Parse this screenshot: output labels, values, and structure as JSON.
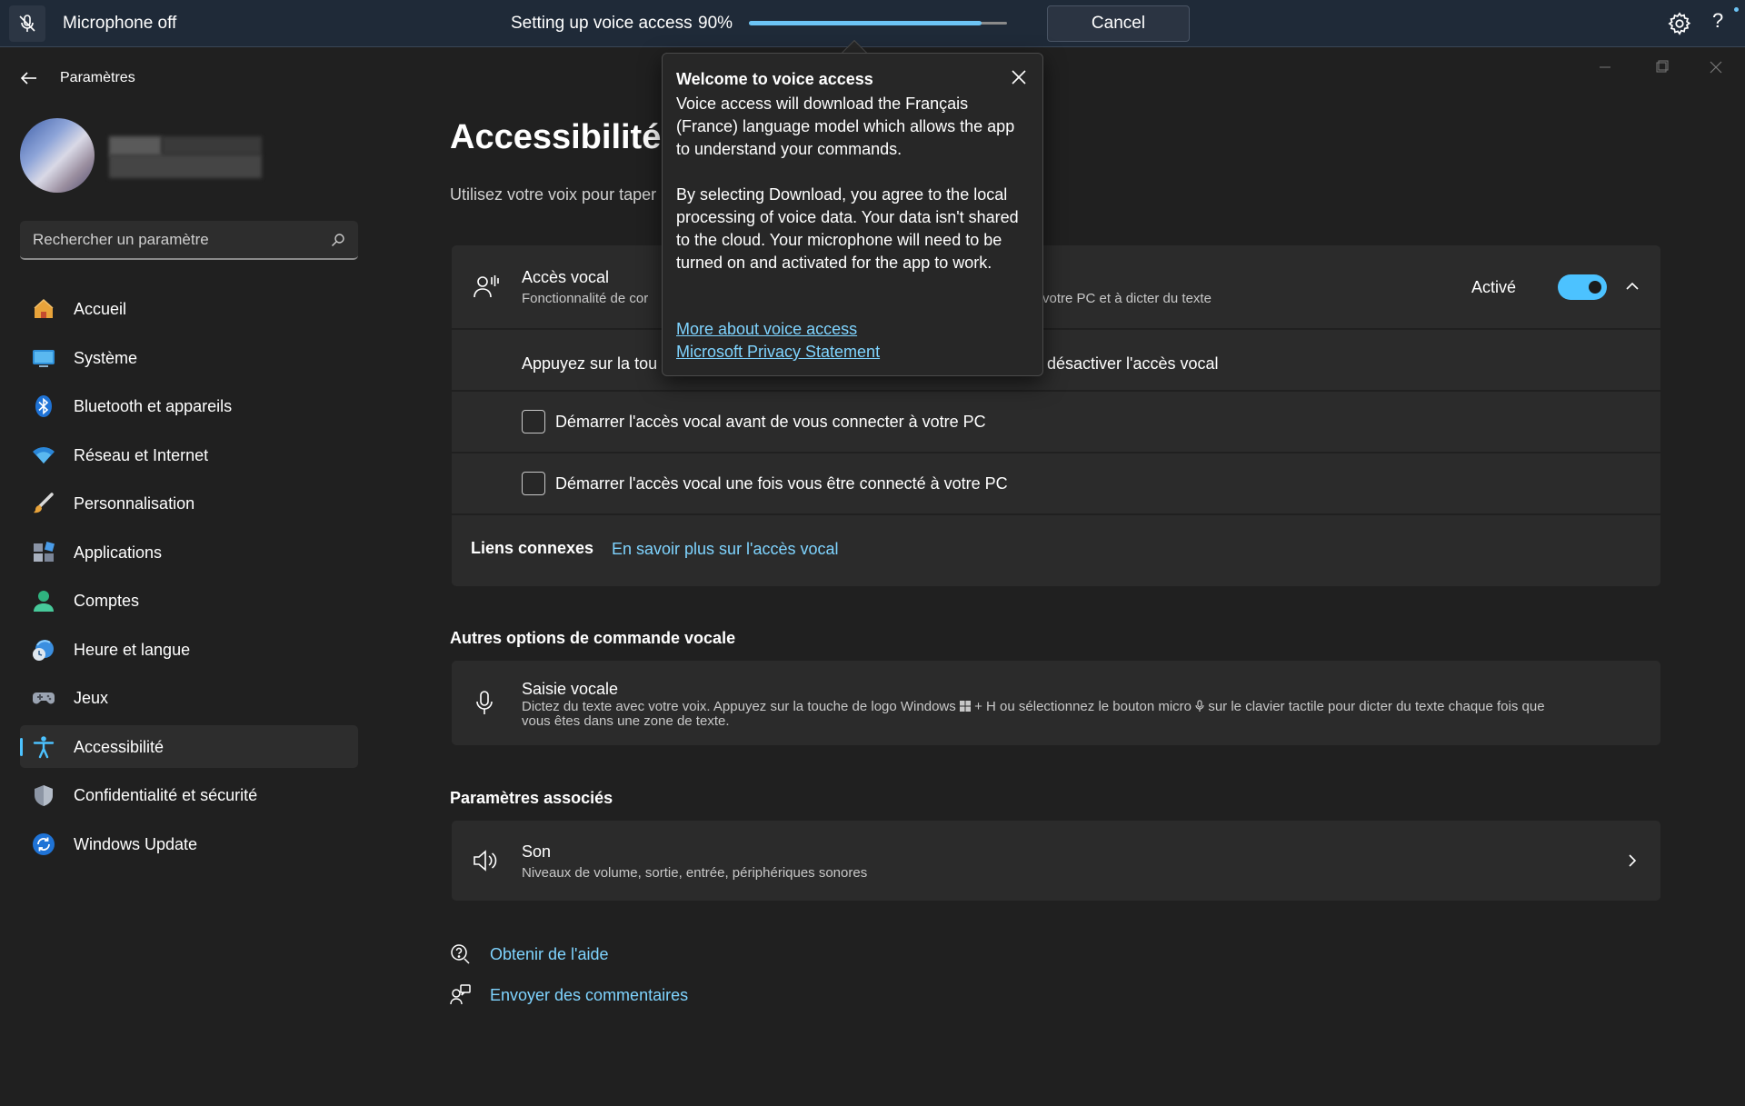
{
  "voice_bar": {
    "mic_status": "Microphone off",
    "setup_label": "Setting up voice access",
    "progress_text": "90%",
    "progress_fraction": 0.9,
    "cancel_label": "Cancel",
    "help_glyph": "?"
  },
  "window": {
    "title": "Paramètres"
  },
  "sidebar": {
    "search_placeholder": "Rechercher un paramètre",
    "items": [
      {
        "label": "Accueil",
        "icon": "home-icon"
      },
      {
        "label": "Système",
        "icon": "system-icon"
      },
      {
        "label": "Bluetooth et appareils",
        "icon": "bluetooth-icon"
      },
      {
        "label": "Réseau et Internet",
        "icon": "wifi-icon"
      },
      {
        "label": "Personnalisation",
        "icon": "brush-icon"
      },
      {
        "label": "Applications",
        "icon": "apps-icon"
      },
      {
        "label": "Comptes",
        "icon": "account-icon"
      },
      {
        "label": "Heure et langue",
        "icon": "clock-globe-icon"
      },
      {
        "label": "Jeux",
        "icon": "gamepad-icon"
      },
      {
        "label": "Accessibilité",
        "icon": "accessibility-icon",
        "active": true
      },
      {
        "label": "Confidentialité et sécurité",
        "icon": "shield-icon"
      },
      {
        "label": "Windows Update",
        "icon": "update-icon"
      }
    ]
  },
  "main": {
    "title": "Accessibilité",
    "subtitle": "Utilisez votre voix pour taper",
    "voice_access": {
      "title": "Accès vocal",
      "desc_left": "Fonctionnalité de cor",
      "desc_right": "votre PC et à dicter du texte",
      "toggle_label": "Activé",
      "toggle_on": true
    },
    "shortcut_row": {
      "left": "Appuyez sur la tou",
      "right": "désactiver l'accès vocal"
    },
    "checkbox_1": "Démarrer l'accès vocal avant de vous connecter à votre PC",
    "checkbox_2": "Démarrer l'accès vocal une fois vous être connecté à votre PC",
    "related_links_label": "Liens connexes",
    "related_link": "En savoir plus sur l'accès vocal",
    "other_options_heading": "Autres options de commande vocale",
    "voice_typing": {
      "title": "Saisie vocale",
      "desc_1": "Dictez du texte avec votre voix. Appuyez sur la touche de logo Windows",
      "desc_2": "+ H ou sélectionnez le bouton micro",
      "desc_3": "sur le clavier tactile pour dicter du texte chaque fois que",
      "desc_4": "vous êtes dans une zone de texte."
    },
    "associated_heading": "Paramètres associés",
    "sound": {
      "title": "Son",
      "desc": "Niveaux de volume, sortie, entrée, périphériques sonores"
    },
    "help_link": "Obtenir de l'aide",
    "feedback_link": "Envoyer des commentaires"
  },
  "popup": {
    "title": "Welcome to voice access",
    "para_1": "Voice access will download the Français (France) language model which allows the app to understand your commands.",
    "para_2": "By selecting Download, you agree to the local processing of voice data. Your data isn't shared to the cloud. Your microphone will need to be turned on and activated for the app to work.",
    "link_1": "More about voice access",
    "link_2": "Microsoft Privacy Statement"
  },
  "colors": {
    "accent": "#4cc2ff",
    "link": "#7fd4ff",
    "background": "#202020",
    "card": "#2b2b2b"
  }
}
